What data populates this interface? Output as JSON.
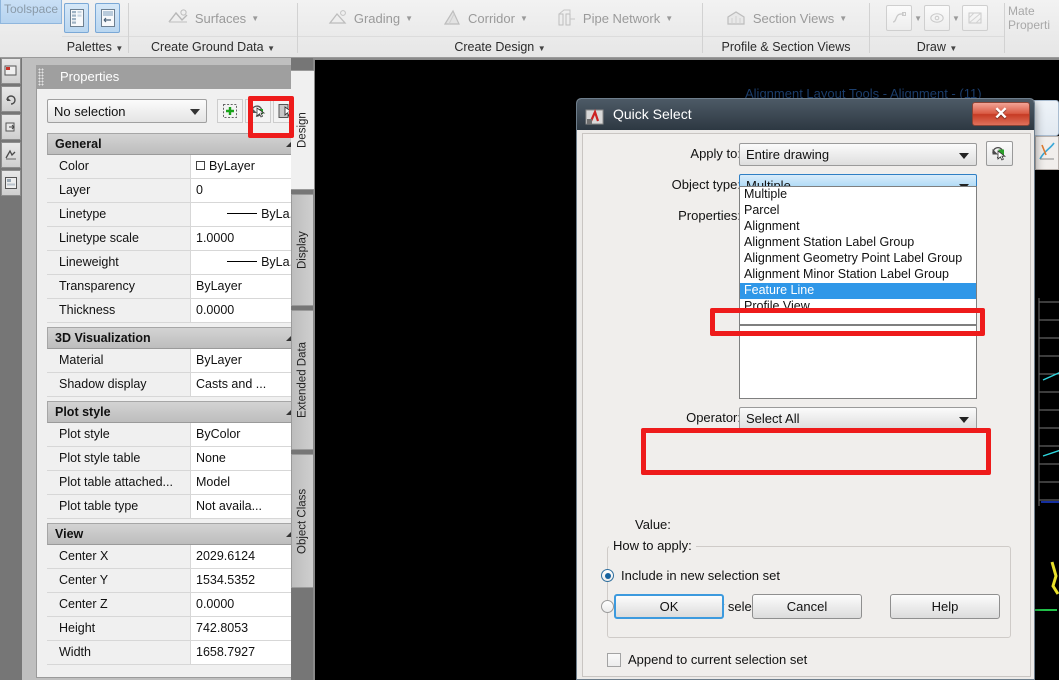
{
  "ribbon": {
    "toolspace_label": "Toolspace",
    "panels": [
      {
        "title": "Palettes",
        "commands": []
      },
      {
        "title": "Create Ground Data",
        "commands": [
          "Surfaces"
        ]
      },
      {
        "title": "Create Design",
        "commands": [
          "Grading",
          "Corridor",
          "Pipe Network"
        ]
      },
      {
        "title": "Profile & Section Views",
        "commands": [
          "Section Views"
        ]
      },
      {
        "title": "Draw",
        "commands": []
      }
    ],
    "surfaces_label": "Surfaces",
    "grading_label": "Grading",
    "corridor_label": "Corridor",
    "pipe_network_label": "Pipe Network",
    "section_views_label": "Section Views",
    "palettes_title": "Palettes",
    "create_ground_data_title": "Create Ground Data",
    "create_design_title": "Create Design",
    "profile_section_views_title": "Profile & Section Views",
    "draw_title": "Draw",
    "material_properties_label_1": "Mate",
    "material_properties_label_2": "Properti"
  },
  "background": {
    "alignment_toolbar_title": "Alignment Layout Tools - Alignment - (11)"
  },
  "properties": {
    "title": "Properties",
    "selection_value": "No selection",
    "buttons": {
      "quick_select": "quick-select-button",
      "select_objects": "select-objects-button",
      "toggle_value": "toggle-value-button"
    },
    "groups": [
      {
        "name": "General",
        "rows": [
          {
            "name": "Color",
            "value": "ByLayer",
            "swatch": true
          },
          {
            "name": "Layer",
            "value": "0"
          },
          {
            "name": "Linetype",
            "value": "ByLa...",
            "line": true,
            "align": "right"
          },
          {
            "name": "Linetype scale",
            "value": "1.0000"
          },
          {
            "name": "Lineweight",
            "value": "ByLa...",
            "line": true,
            "align": "right"
          },
          {
            "name": "Transparency",
            "value": "ByLayer"
          },
          {
            "name": "Thickness",
            "value": "0.0000"
          }
        ]
      },
      {
        "name": "3D Visualization",
        "rows": [
          {
            "name": "Material",
            "value": "ByLayer"
          },
          {
            "name": "Shadow display",
            "value": "Casts and ..."
          }
        ]
      },
      {
        "name": "Plot style",
        "rows": [
          {
            "name": "Plot style",
            "value": "ByColor"
          },
          {
            "name": "Plot style table",
            "value": "None"
          },
          {
            "name": "Plot table attached...",
            "value": "Model"
          },
          {
            "name": "Plot table type",
            "value": "Not availa..."
          }
        ]
      },
      {
        "name": "View",
        "rows": [
          {
            "name": "Center X",
            "value": "2029.6124"
          },
          {
            "name": "Center Y",
            "value": "1534.5352"
          },
          {
            "name": "Center Z",
            "value": "0.0000"
          },
          {
            "name": "Height",
            "value": "742.8053"
          },
          {
            "name": "Width",
            "value": "1658.7927"
          }
        ]
      }
    ],
    "vertical_tabs": [
      {
        "label": "Design",
        "active": true
      },
      {
        "label": "Display",
        "active": false
      },
      {
        "label": "Extended Data",
        "active": false
      },
      {
        "label": "Object Class",
        "active": false
      }
    ]
  },
  "quick_select": {
    "title": "Quick Select",
    "close_label": "✕",
    "apply_to_label": "Apply to:",
    "apply_to_value": "Entire drawing",
    "object_type_label": "Object type:",
    "object_type_value": "Multiple",
    "properties_label": "Properties:",
    "object_type_options": [
      "Multiple",
      "Parcel",
      "Alignment",
      "Alignment Station Label Group",
      "Alignment Geometry Point Label Group",
      "Alignment Minor Station Label Group",
      "Feature Line",
      "Profile View"
    ],
    "selected_option": "Feature Line",
    "operator_label": "Operator:",
    "operator_value": "Select All",
    "value_label": "Value:",
    "how_to_apply_label": "How to apply:",
    "include_label": "Include in new selection set",
    "exclude_label": "Exclude from new selection set",
    "include_checked": true,
    "append_label": "Append to current selection set",
    "append_checked": false,
    "ok_label": "OK",
    "cancel_label": "Cancel",
    "help_label": "Help"
  },
  "colors": {
    "annotation_red": "#ee1b1b",
    "selection_blue": "#2f97e8",
    "canvas_black": "#000000",
    "title_dark": "#2d3842"
  }
}
